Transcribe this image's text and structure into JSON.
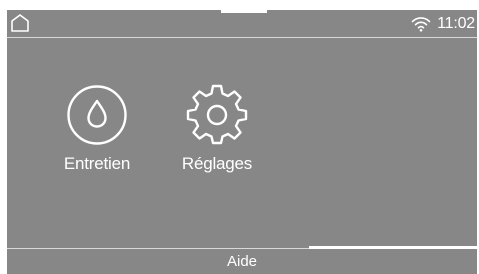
{
  "status_bar": {
    "time": "11:02",
    "icons": [
      "home-icon",
      "wifi-icon"
    ]
  },
  "menu": {
    "items": [
      {
        "label": "Entretien",
        "icon": "water-drop-icon"
      },
      {
        "label": "Réglages",
        "icon": "gear-icon"
      }
    ]
  },
  "footer": {
    "help_label": "Aide"
  },
  "colors": {
    "background": "#878787",
    "foreground": "#ffffff"
  }
}
